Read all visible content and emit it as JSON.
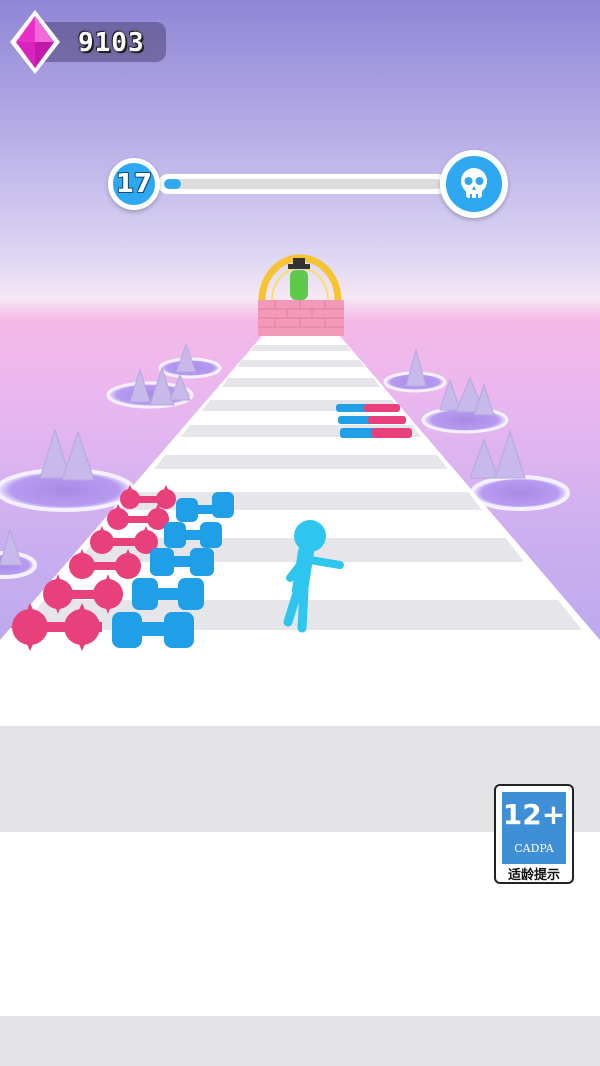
{
  "hud": {
    "gem_count": "9103",
    "gem_icon": "pink-gem-icon"
  },
  "level": {
    "current": "17",
    "progress": 0.06,
    "end_icon": "skull-icon"
  },
  "age_rating": {
    "age": "12+",
    "org": "CADPA",
    "caption": "适龄提示"
  },
  "colors": {
    "accent_blue": "#2ea8f0",
    "gem_pink": "#e830c8",
    "weight_red": "#e8407a",
    "weight_blue": "#1f9fe8"
  }
}
